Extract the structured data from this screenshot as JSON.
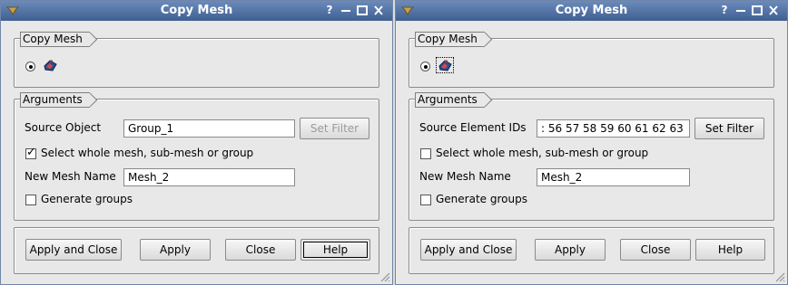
{
  "dialogs": [
    {
      "title": "Copy Mesh",
      "titlebar_buttons": {
        "help": "?"
      },
      "copy_mesh_group": {
        "title": "Copy Mesh",
        "icon": "mesh-copy-icon",
        "selected": true
      },
      "arguments_group": {
        "title": "Arguments",
        "source_label": "Source Object",
        "source_value": "Group_1",
        "set_filter_label": "Set Filter",
        "set_filter_enabled": false,
        "select_whole_label": "Select whole mesh, sub-mesh or group",
        "select_whole_checked": true,
        "new_mesh_label": "New Mesh Name",
        "new_mesh_value": "Mesh_2",
        "generate_groups_label": "Generate groups",
        "generate_groups_checked": false
      },
      "buttons": {
        "apply_close": "Apply and Close",
        "apply": "Apply",
        "close": "Close",
        "help": "Help"
      }
    },
    {
      "title": "Copy Mesh",
      "titlebar_buttons": {
        "help": "?"
      },
      "copy_mesh_group": {
        "title": "Copy Mesh",
        "icon": "mesh-copy-icon",
        "selected": true
      },
      "arguments_group": {
        "title": "Arguments",
        "source_label": "Source Element IDs",
        "source_value": ": 56 57 58 59 60 61 62 63",
        "set_filter_label": "Set Filter",
        "set_filter_enabled": true,
        "select_whole_label": "Select whole mesh, sub-mesh or group",
        "select_whole_checked": false,
        "new_mesh_label": "New Mesh Name",
        "new_mesh_value": "Mesh_2",
        "generate_groups_label": "Generate groups",
        "generate_groups_checked": false
      },
      "buttons": {
        "apply_close": "Apply and Close",
        "apply": "Apply",
        "close": "Close",
        "help": "Help"
      }
    }
  ],
  "colors": {
    "titlebar": "#4f6fa3",
    "dialog_bg": "#e8e8e8",
    "disabled_text": "#9a9a9a"
  }
}
